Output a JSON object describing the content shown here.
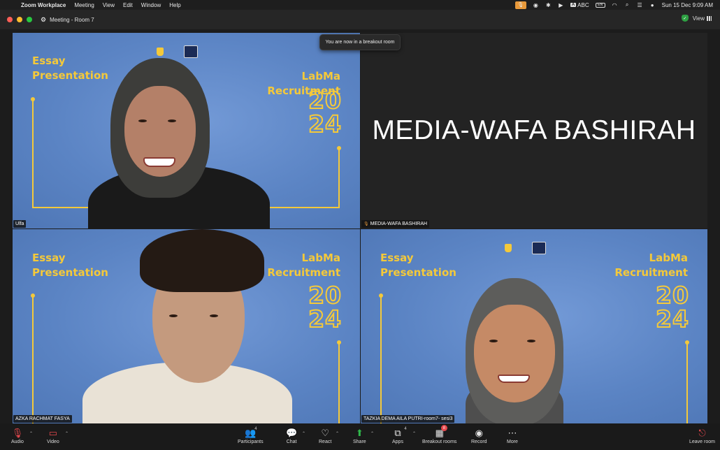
{
  "menubar": {
    "app_name": "Zoom Workplace",
    "menus": [
      "Meeting",
      "View",
      "Edit",
      "Window",
      "Help"
    ],
    "keyboard_indicator": "ABC",
    "battery_label": "EN",
    "clock": "Sun 15 Dec  9:09 AM"
  },
  "window": {
    "title": "Meeting - Room 7",
    "view_label": "View"
  },
  "tooltip": "You are now in a breakout room",
  "tiles": {
    "slide": {
      "essay_line1": "Essay",
      "essay_line2": "Presentation",
      "labma_line1": "LabMa",
      "labma_line2": "Recruitment",
      "year_line1": "20",
      "year_line2": "24"
    },
    "top_left": {
      "name": "Ulfa"
    },
    "top_right": {
      "display_name": "MEDIA-WAFA BASHIRAH",
      "name": "MEDIA-WAFA BASHIRAH"
    },
    "bottom_left": {
      "name": "AZKA RACHMAT FASYA"
    },
    "bottom_right": {
      "name": "TAZKIA DEMA AILA PUTRI-room7- sesi3"
    }
  },
  "toolbar": {
    "audio": "Audio",
    "video": "Video",
    "participants": "Participants",
    "participants_count": "4",
    "chat": "Chat",
    "react": "React",
    "share": "Share",
    "apps": "Apps",
    "apps_count": "4",
    "breakout": "Breakout rooms",
    "breakout_badge": "8",
    "record": "Record",
    "more": "More",
    "leave": "Leave room"
  },
  "colors": {
    "accent_yellow": "#f4c93a",
    "slide_blue": "#5b84c4",
    "active_speaker": "#6fd34e",
    "leave_red": "#e5484d",
    "share_green": "#2fb74a"
  }
}
